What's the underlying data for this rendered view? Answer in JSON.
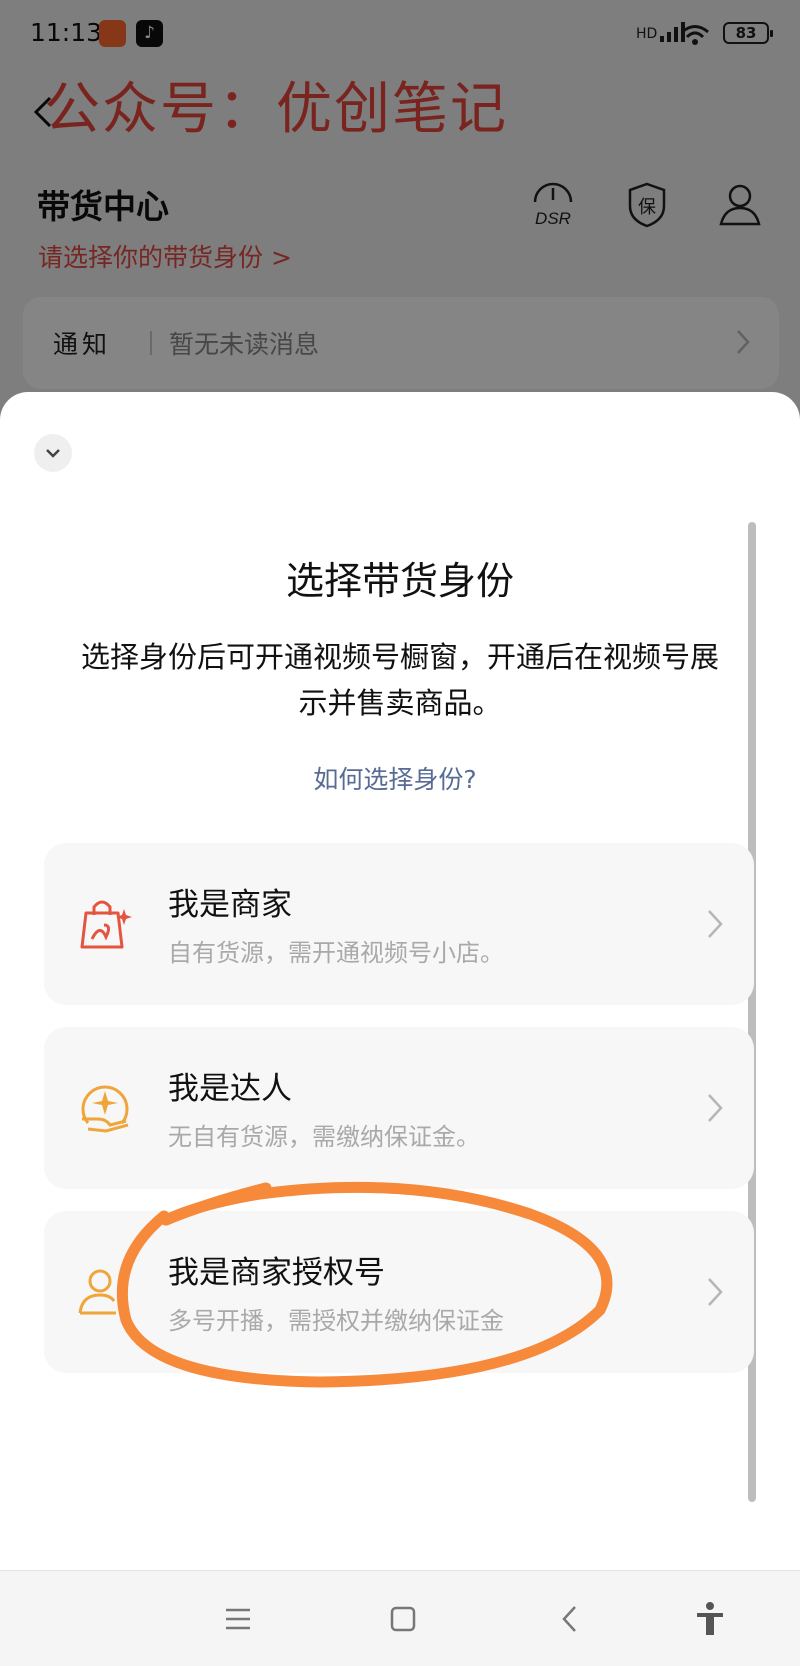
{
  "status_bar": {
    "time": "11:13",
    "network": "HD",
    "battery": "83"
  },
  "watermark": "公众号：优创笔记",
  "background_page": {
    "title": "带货中心",
    "subtitle": "请选择你的带货身份 >",
    "header_icons": {
      "dsr_label": "DSR",
      "bao_label": "保"
    },
    "notice": {
      "title": "通知",
      "text": "暂无未读消息"
    }
  },
  "sheet": {
    "title": "选择带货身份",
    "description": "选择身份后可开通视频号橱窗，开通后在视频号展示并售卖商品。",
    "help_link": "如何选择身份?",
    "options": [
      {
        "title": "我是商家",
        "desc": "自有货源，需开通视频号小店。",
        "icon": "shopping-bag-icon",
        "color": "#e4543f"
      },
      {
        "title": "我是达人",
        "desc": "无自有货源，需缴纳保证金。",
        "icon": "star-hand-icon",
        "color": "#f0a53a"
      },
      {
        "title": "我是商家授权号",
        "desc": "多号开播，需授权并缴纳保证金",
        "icon": "person-outline-icon",
        "color": "#f0a53a"
      }
    ]
  },
  "annotation_color": "#f7893a"
}
